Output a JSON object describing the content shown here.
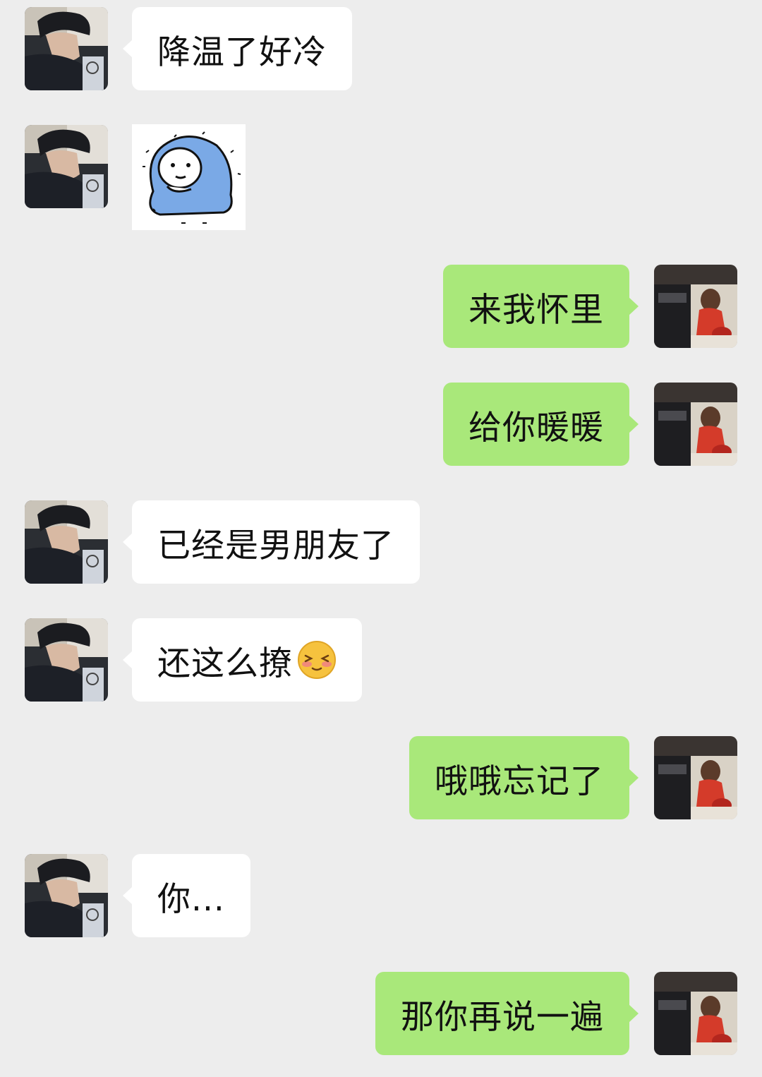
{
  "contacts": {
    "other": {
      "avatar_icon": "avatar-boy-photo-icon"
    },
    "self": {
      "avatar_icon": "avatar-girl-photo-icon"
    }
  },
  "messages": [
    {
      "from": "other",
      "text": "降温了好冷"
    },
    {
      "from": "other",
      "sticker": "blue-blanket-sticker"
    },
    {
      "from": "self",
      "text": "来我怀里"
    },
    {
      "from": "self",
      "text": "给你暖暖"
    },
    {
      "from": "other",
      "text": "已经是男朋友了"
    },
    {
      "from": "other",
      "text": "还这么撩",
      "emoji": "blushing-face-emoji"
    },
    {
      "from": "self",
      "text": "哦哦忘记了"
    },
    {
      "from": "other",
      "text": "你..."
    },
    {
      "from": "self",
      "text": "那你再说一遍"
    }
  ],
  "colors": {
    "background": "#ededed",
    "incoming_bubble": "#ffffff",
    "outgoing_bubble": "#a9e87a"
  }
}
